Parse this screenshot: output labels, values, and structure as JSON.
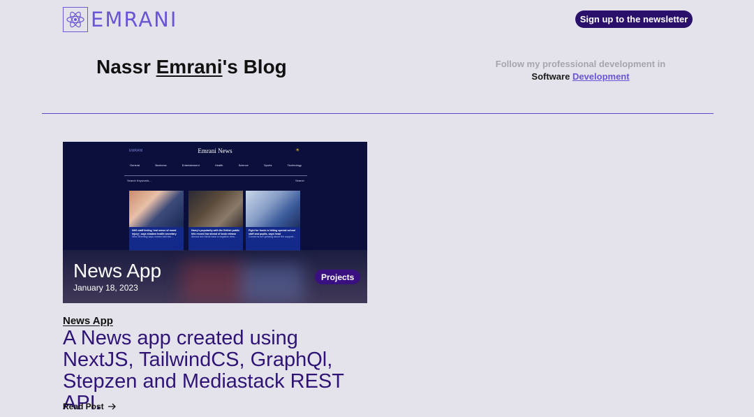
{
  "header": {
    "logo_text": "EMRANI",
    "newsletter_button": "Sign up to the newsletter"
  },
  "hero": {
    "title_prefix": "Nassr ",
    "title_name": "Emrani",
    "title_suffix": "'s Blog",
    "tagline_line1": "Follow my professional development in",
    "tagline_word": "Software",
    "tagline_link": "Development"
  },
  "post": {
    "image_mockup": {
      "brand": "EMRANI",
      "title": "Emrani News",
      "nav": [
        "General",
        "Business",
        "Entertainment",
        "Health",
        "Science",
        "Sports",
        "Technology"
      ],
      "search_placeholder": "Search Keywords...",
      "search_button": "Search",
      "articles": [
        {
          "headline": "NHS staff feeling 'real sense of moral injury', says shadow health secretary",
          "snippet": "Wes Streeting says nurses told him..."
        },
        {
          "headline": "Harry's popularity with the British public hits record low ahead of book release",
          "snippet": "Almost two thirds have a negative view..."
        },
        {
          "headline": "Fight for funds is hitting special school staff and pupils, says head",
          "snippet": "Concerns are growing about the support..."
        }
      ]
    },
    "title": "News App",
    "date": "January 18, 2023",
    "category": "Projects",
    "label": "News App",
    "description": "A News app created using NextJS, TailwindCS, GraphQl, Stepzen and Mediastack REST API.",
    "read_more": "Read Post"
  },
  "colors": {
    "background": "#e4e3eb",
    "accent": "#6a55d4",
    "primary_dark": "#2a0f6b",
    "description_text": "#2f1475"
  },
  "icons": {
    "logo": "atom-icon",
    "read_more": "arrow-right-icon"
  }
}
